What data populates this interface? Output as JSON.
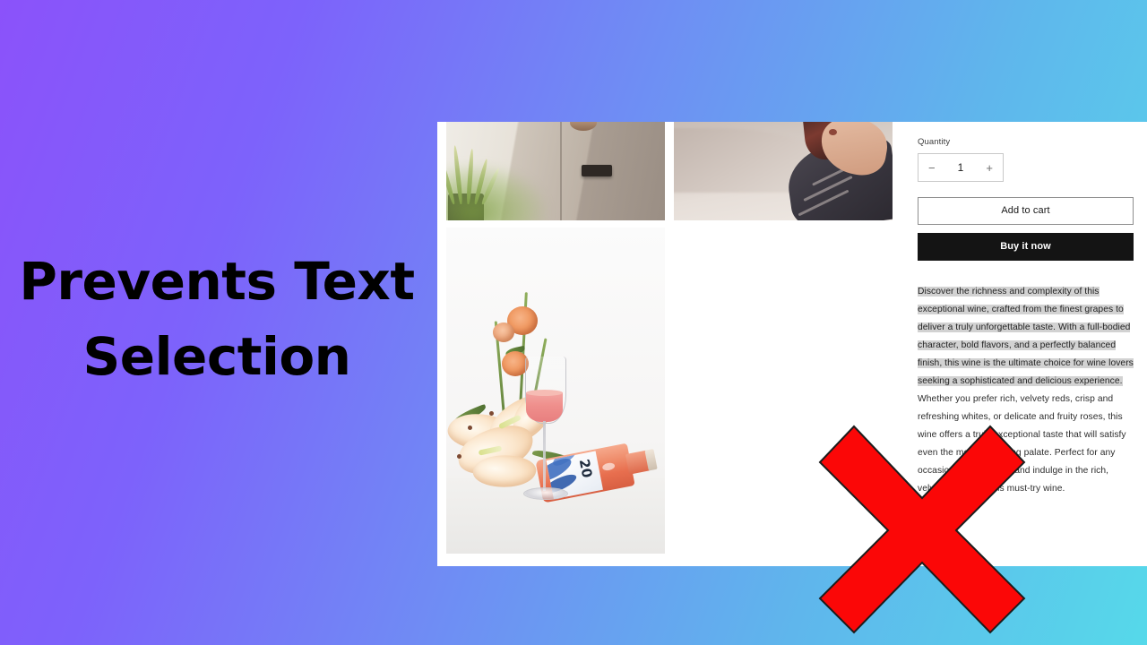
{
  "slide": {
    "headline_line1": "Prevents Text",
    "headline_line2": "Selection",
    "background_from": "#8b52fa",
    "background_to": "#56d9ea",
    "marker_color": "#fb0707",
    "marker_symbol": "x-mark"
  },
  "product_panel": {
    "gallery": {
      "images": [
        {
          "name": "concrete-side-table-with-plant",
          "alt": "Concrete side table with potted plant"
        },
        {
          "name": "person-holding-wine-glass",
          "alt": "Person seated holding a glass of red wine"
        },
        {
          "name": "rose-wine-bottle-with-flowers",
          "alt": "Rose wine bottle, filled glass and lilies",
          "bottle_label_number": "20"
        }
      ]
    },
    "quantity": {
      "label": "Quantity",
      "value": "1",
      "decrease_symbol": "−",
      "increase_symbol": "+"
    },
    "actions": {
      "add_to_cart": "Add to cart",
      "buy_it_now": "Buy it now"
    },
    "description": {
      "selected_text": "Discover the richness and complexity of this exceptional wine, crafted from the finest grapes to deliver a truly unforgettable taste. With a full-bodied character, bold flavors, and a perfectly balanced finish, this wine is the ultimate choice for wine lovers seeking a sophisticated and delicious experience.",
      "unselected_text": " Whether you prefer rich, velvety reds, crisp and refreshing whites, or delicate and fruity roses, this wine offers a truly exceptional taste that will satisfy even the most discerning palate. Perfect for any occasion, raise a glass and indulge in the rich, velvety flavors of this must-try wine.",
      "selection_highlight_color": "#d2d2d2"
    }
  }
}
